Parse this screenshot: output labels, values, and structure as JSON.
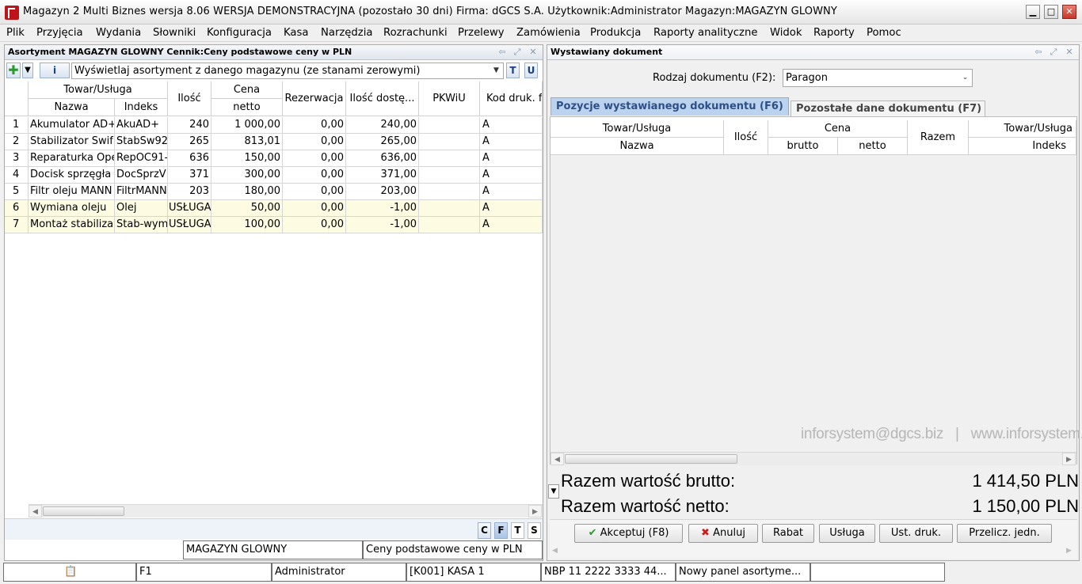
{
  "window": {
    "title": "Magazyn 2 Multi Biznes wersja 8.06  WERSJA DEMONSTRACYJNA (pozostało 30 dni)  Firma: dGCS S.A.   Użytkownik:Administrator    Magazyn:MAGAZYN GLOWNY"
  },
  "menu": [
    "Plik",
    "Przyjęcia",
    "Wydania",
    "Słowniki",
    "Konfiguracja",
    "Kasa",
    "Narzędzia",
    "Rozrachunki",
    "Przelewy",
    "Zamówienia",
    "Produkcja",
    "Raporty analityczne",
    "Widok",
    "Raporty",
    "Pomoc"
  ],
  "left": {
    "header": "Asortyment MAGAZYN GLOWNY Cennik:Ceny podstawowe ceny w PLN",
    "filter_value": "Wyświetlaj asortyment z danego magazynu (ze stanami zerowymi)",
    "btn_t": "T",
    "btn_u": "U",
    "btn_info": "i",
    "columns": {
      "group_towar": "Towar/Usługa",
      "nazwa": "Nazwa",
      "indeks": "Indeks",
      "ilosc": "Ilość",
      "group_cena": "Cena",
      "netto": "netto",
      "rezerwacja": "Rezerwacja",
      "dostepna": "Ilość dostę...",
      "pkwiu": "PKWiU",
      "kod": "Kod druk. f"
    },
    "rows": [
      {
        "no": "1",
        "nazwa": "Akumulator AD+",
        "indeks": "AkuAD+",
        "ilosc": "240",
        "netto": "1 000,00",
        "rez": "0,00",
        "dost": "240,00",
        "pkwiu": "",
        "kod": "A",
        "service": false
      },
      {
        "no": "2",
        "nazwa": "Stabilizator Swif",
        "indeks": "StabSw92",
        "ilosc": "265",
        "netto": "813,01",
        "rez": "0,00",
        "dost": "265,00",
        "pkwiu": "",
        "kod": "A",
        "service": false
      },
      {
        "no": "3",
        "nazwa": "Reparaturka Ope",
        "indeks": "RepOC91-",
        "ilosc": "636",
        "netto": "150,00",
        "rez": "0,00",
        "dost": "636,00",
        "pkwiu": "",
        "kod": "A",
        "service": false
      },
      {
        "no": "4",
        "nazwa": "Docisk sprzęgła",
        "indeks": "DocSprzV",
        "ilosc": "371",
        "netto": "300,00",
        "rez": "0,00",
        "dost": "371,00",
        "pkwiu": "",
        "kod": "A",
        "service": false
      },
      {
        "no": "5",
        "nazwa": "Filtr oleju MANN",
        "indeks": "FiltrMANN",
        "ilosc": "203",
        "netto": "180,00",
        "rez": "0,00",
        "dost": "203,00",
        "pkwiu": "",
        "kod": "A",
        "service": false
      },
      {
        "no": "6",
        "nazwa": "Wymiana oleju",
        "indeks": "Olej",
        "ilosc": "USŁUGA",
        "netto": "50,00",
        "rez": "0,00",
        "dost": "-1,00",
        "pkwiu": "",
        "kod": "A",
        "service": true
      },
      {
        "no": "7",
        "nazwa": "Montaż stabiliza",
        "indeks": "Stab-wym",
        "ilosc": "USŁUGA",
        "netto": "100,00",
        "rez": "0,00",
        "dost": "-1,00",
        "pkwiu": "",
        "kod": "A",
        "service": true
      }
    ],
    "bottom_buttons": [
      "C",
      "F",
      "T",
      "S"
    ],
    "status_magazyn": "MAGAZYN GLOWNY",
    "status_cennik": "Ceny podstawowe ceny w PLN"
  },
  "right": {
    "header": "Wystawiany dokument",
    "doc_type_label": "Rodzaj dokumentu (F2):",
    "doc_type_value": "Paragon",
    "tabs": [
      "Pozycje wystawianego dokumentu (F6)",
      "Pozostałe dane dokumentu (F7)"
    ],
    "columns": {
      "group_towar": "Towar/Usługa",
      "nazwa": "Nazwa",
      "ilosc": "Ilość",
      "group_cena": "Cena",
      "brutto": "brutto",
      "netto": "netto",
      "razem": "Razem",
      "group_towar2": "Towar/Usługa",
      "indeks": "Indeks"
    },
    "watermark": "inforsystem@dgcs.biz   |   www.inforsystem.pl",
    "total_brutto_label": "Razem wartość brutto:",
    "total_brutto_value": "1 414,50 PLN",
    "total_netto_label": "Razem wartość netto:",
    "total_netto_value": "1 150,00 PLN",
    "buttons": {
      "accept": "Akceptuj (F8)",
      "cancel": "Anuluj",
      "discount": "Rabat",
      "service": "Usługa",
      "print_settings": "Ust. druk.",
      "recalc": "Przelicz. jedn."
    }
  },
  "statusbar": [
    "F1",
    "Administrator",
    "[K001] KASA 1",
    "NBP 11 2222 3333 44...",
    "Nowy panel asortyme...",
    ""
  ],
  "colors": {
    "accent_tab": "#bcd3ef",
    "service_row": "#fdfbe1",
    "close_btn": "#c4382a",
    "app_icon": "#c0141b"
  }
}
